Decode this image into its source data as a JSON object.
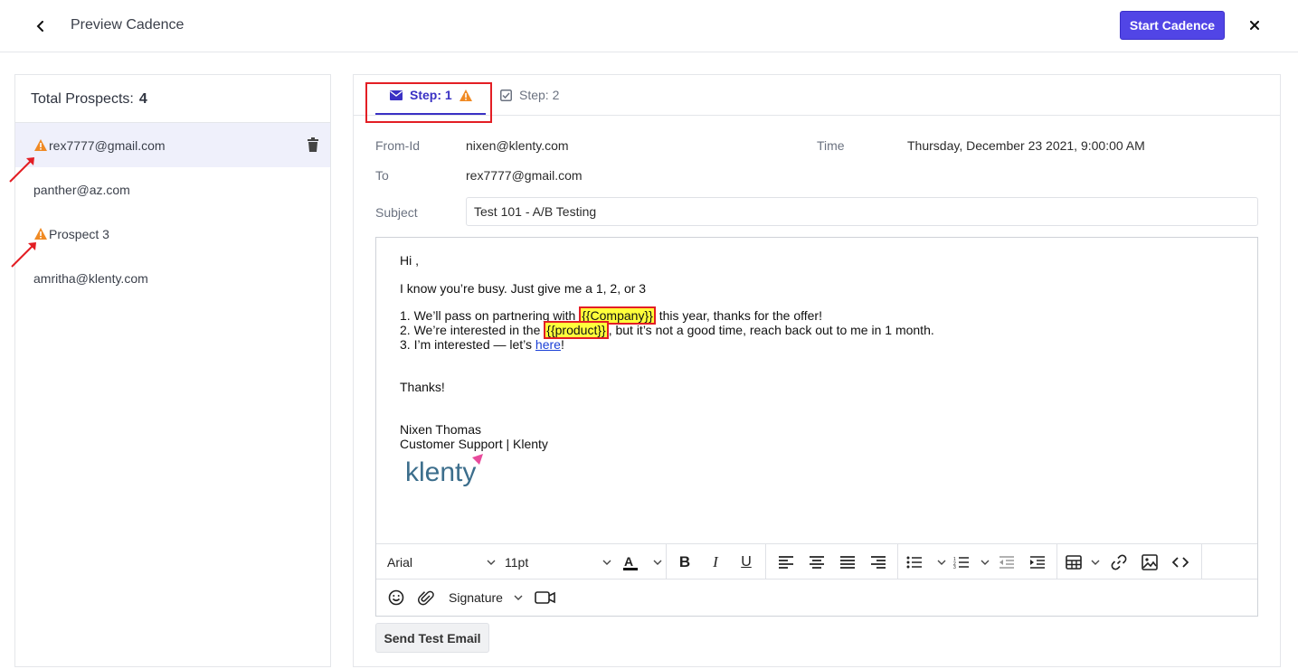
{
  "header": {
    "title": "Preview Cadence",
    "start_button": "Start Cadence"
  },
  "prospects": {
    "label": "Total Prospects:",
    "count": "4",
    "items": [
      {
        "email": "rex7777@gmail.com",
        "warning": true,
        "active": true
      },
      {
        "email": "panther@az.com",
        "warning": false,
        "active": false
      },
      {
        "email": "Prospect 3",
        "warning": true,
        "active": false
      },
      {
        "email": "amritha@klenty.com",
        "warning": false,
        "active": false
      }
    ]
  },
  "tabs": [
    {
      "label": "Step: 1",
      "icon": "mail-icon",
      "warning": true,
      "active": true
    },
    {
      "label": "Step: 2",
      "icon": "checkbox-icon",
      "warning": false,
      "active": false
    }
  ],
  "email": {
    "from_label": "From-Id",
    "from_value": "nixen@klenty.com",
    "time_label": "Time",
    "time_value": "Thursday, December 23 2021, 9:00:00 AM",
    "to_label": "To",
    "to_value": "rex7777@gmail.com",
    "subject_label": "Subject",
    "subject_value": "Test 101 - A/B Testing",
    "body": {
      "greeting": "Hi ,",
      "intro": "I know you’re busy. Just give me a 1, 2, or 3",
      "line1_pre": "1. We’ll pass on partnering with ",
      "line1_var": "{{Company}}",
      "line1_post": " this year, thanks for the offer!",
      "line2_pre": "2. We’re interested in the ",
      "line2_var": "{{product}}",
      "line2_post": ", but it’s not a good time, reach back out to me in 1 month.",
      "line3_pre": "3. I’m interested — let’s ",
      "line3_link": "here",
      "line3_post": "!",
      "thanks": "Thanks!",
      "sig_name": "Nixen Thomas",
      "sig_title": "Customer Support | Klenty",
      "logo_text": "klenty"
    }
  },
  "toolbar": {
    "font": "Arial",
    "size": "11pt",
    "signature": "Signature"
  },
  "send_test": "Send Test Email",
  "colors": {
    "accent": "#5145e6",
    "tab_active": "#3a31c4",
    "warning": "#f08a24",
    "annotation": "#e31e24",
    "highlight": "#ffff3b"
  }
}
